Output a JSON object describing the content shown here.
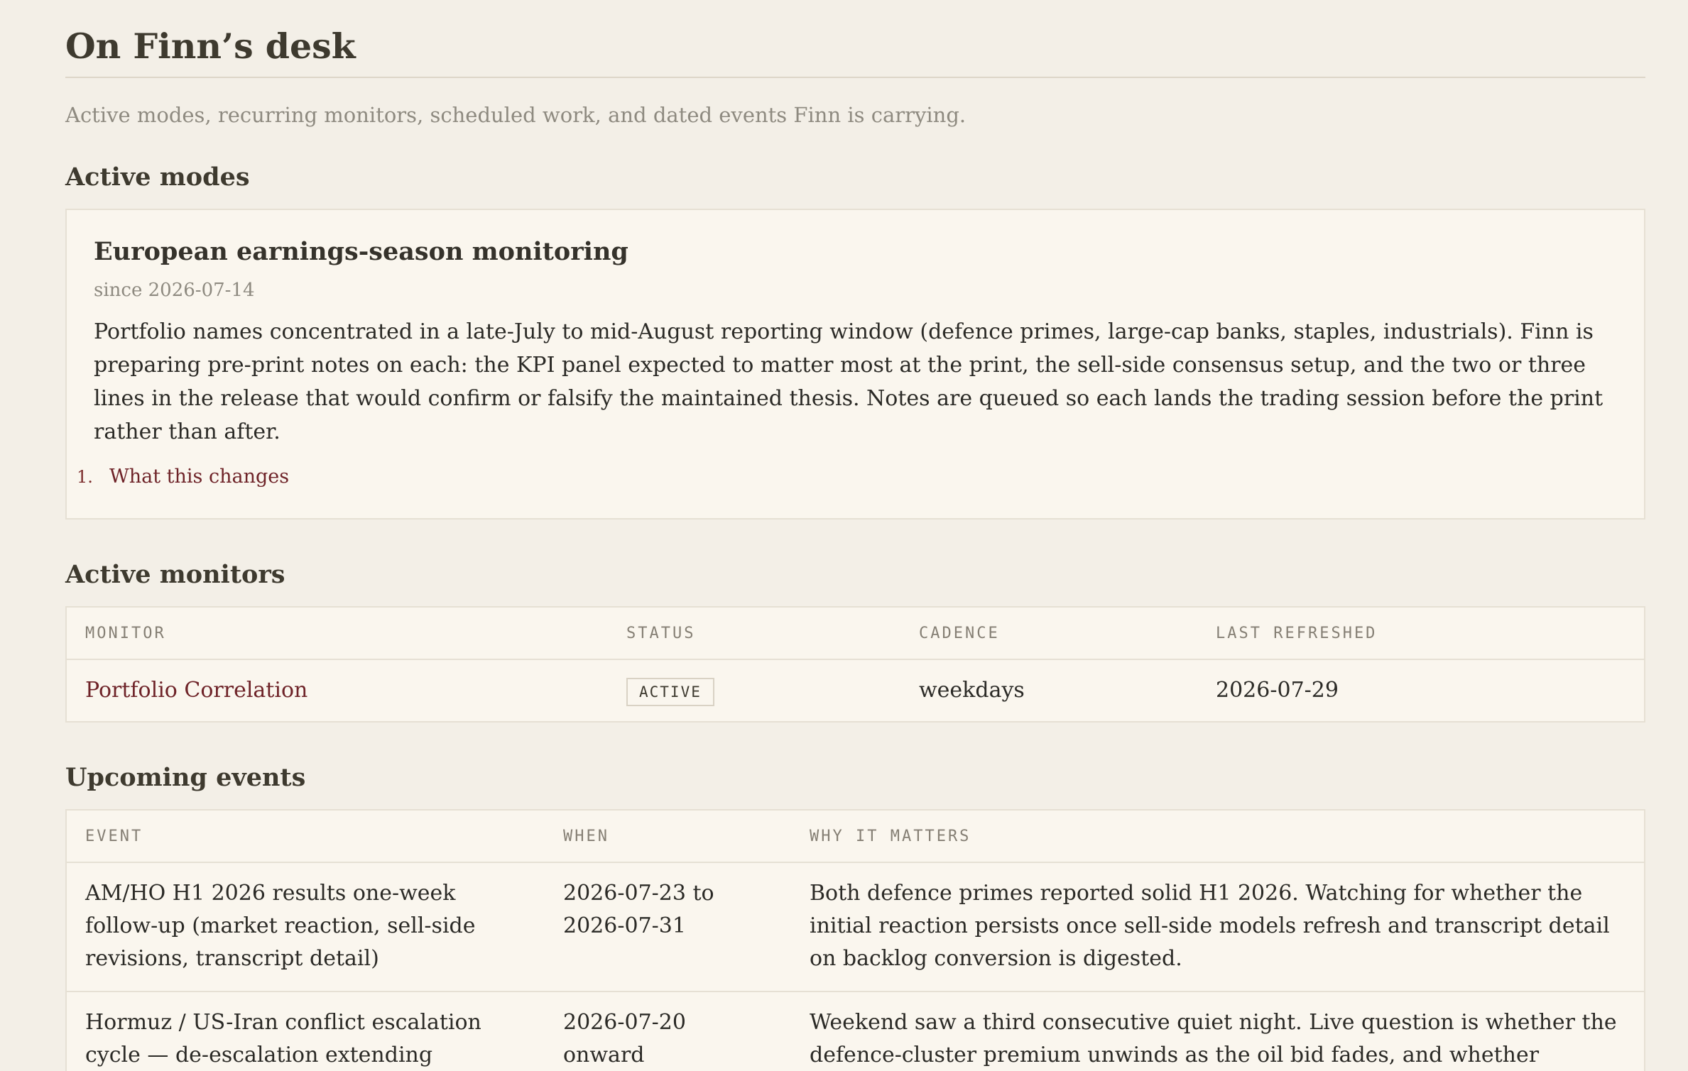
{
  "header": {
    "title": "On Finn’s desk",
    "subtitle": "Active modes, recurring monitors, scheduled work, and dated events Finn is carrying."
  },
  "modes": {
    "heading": "Active modes",
    "items": [
      {
        "title": "European earnings-season monitoring",
        "since": "since 2026-07-14",
        "body": "Portfolio names concentrated in a late-July to mid-August reporting window (defence primes, large-cap banks, staples, industrials). Finn is preparing pre-print notes on each: the KPI panel expected to matter most at the print, the sell-side consensus setup, and the two or three lines in the release that would confirm or falsify the maintained thesis. Notes are queued so each lands the trading session before the print rather than after.",
        "list_number": "1.",
        "list_link": "What this changes"
      }
    ]
  },
  "monitors": {
    "heading": "Active monitors",
    "columns": [
      "MONITOR",
      "STATUS",
      "CADENCE",
      "LAST REFRESHED"
    ],
    "rows": [
      {
        "monitor": "Portfolio Correlation",
        "status": "ACTIVE",
        "cadence": "weekdays",
        "last_refreshed": "2026-07-29"
      }
    ]
  },
  "events": {
    "heading": "Upcoming events",
    "columns": [
      "EVENT",
      "WHEN",
      "WHY IT MATTERS"
    ],
    "rows": [
      {
        "event": "AM/HO H1 2026 results one-week follow-up (market reaction, sell-side revisions, transcript detail)",
        "when": "2026-07-23 to 2026-07-31",
        "why": "Both defence primes reported solid H1 2026. Watching for whether the initial reaction persists once sell-side models refresh and transcript detail on backlog conversion is digested."
      },
      {
        "event": "Hormuz / US-Iran conflict escalation cycle — de-escalation extending",
        "when": "2026-07-20 onward",
        "why": "Weekend saw a third consecutive quiet night. Live question is whether the defence-cluster premium unwinds as the oil bid fades, and whether shipping/insurance rates normalise to pre-crisis levels."
      }
    ]
  },
  "colors": {
    "background": "#f3efe7",
    "card": "#faf6ee",
    "border": "#e6e0d4",
    "link": "#6e2328",
    "muted": "#8e8a80"
  }
}
